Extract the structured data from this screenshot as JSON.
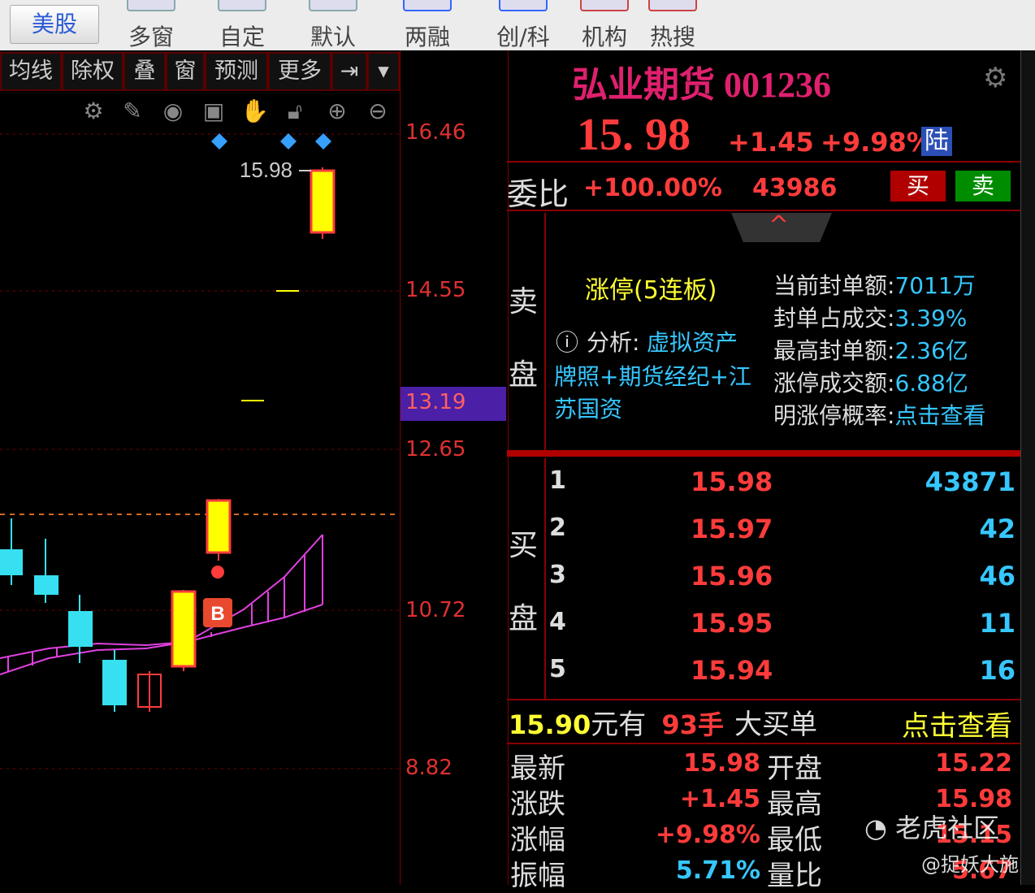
{
  "toolbar": {
    "market_button": "美股",
    "buttons": [
      "多窗",
      "自定",
      "默认",
      "两融",
      "创/科",
      "机构",
      "热搜"
    ]
  },
  "chart": {
    "indicator_tabs": [
      "均线",
      "除权",
      "叠",
      "窗",
      "预测",
      "更多"
    ],
    "tools": [
      "settings-icon",
      "pen-icon",
      "eye-icon",
      "basket-icon",
      "hand-icon",
      "lock-icon",
      "zoom-in-icon",
      "zoom-out-icon"
    ],
    "high_label": "15.98",
    "buy_marker": "B"
  },
  "axis": {
    "ticks": [
      "16.46",
      "14.55",
      "13.19",
      "12.65",
      "10.72",
      "8.82"
    ],
    "highlight": "13.19"
  },
  "quote": {
    "name_code": "弘业期货 001236",
    "price": "15. 98",
    "change": "+1.45",
    "change_pct": "+9.98%",
    "exchange_badge": "陆",
    "weibi_label": "委比",
    "weibi_value": "+100.00%",
    "weibi_qty": "43986",
    "buy_btn": "买",
    "sell_btn": "卖"
  },
  "limit_up": {
    "side_label_1": "卖",
    "side_label_2": "盘",
    "title": "涨停(5连板)",
    "analysis_label": "分析:",
    "analysis_text_1": "虚拟资产",
    "analysis_text_2": "牌照+期货经纪+江",
    "analysis_text_3": "苏国资",
    "stats": [
      {
        "label": "当前封单额:",
        "value": "7011万"
      },
      {
        "label": "封单占成交:",
        "value": "3.39%"
      },
      {
        "label": "最高封单额:",
        "value": "2.36亿"
      },
      {
        "label": "涨停成交额:",
        "value": "6.88亿"
      },
      {
        "label": "明涨停概率:",
        "value": "点击查看"
      }
    ]
  },
  "bids": {
    "side_label_1": "买",
    "side_label_2": "盘",
    "rows": [
      {
        "level": "1",
        "price": "15.98",
        "qty": "43871"
      },
      {
        "level": "2",
        "price": "15.97",
        "qty": "42"
      },
      {
        "level": "3",
        "price": "15.96",
        "qty": "46"
      },
      {
        "level": "4",
        "price": "15.95",
        "qty": "11"
      },
      {
        "level": "5",
        "price": "15.94",
        "qty": "16"
      }
    ]
  },
  "big_order": {
    "price": "15.90",
    "unit": "元有",
    "hands": "93手",
    "text": "大买单",
    "link": "点击查看"
  },
  "stats": [
    {
      "label": "最新",
      "value": "15.98",
      "label2": "开盘",
      "value2": "15.22"
    },
    {
      "label": "涨跌",
      "value": "+1.45",
      "label2": "最高",
      "value2": "15.98"
    },
    {
      "label": "涨幅",
      "value": "+9.98%",
      "label2": "最低",
      "value2": "15.15"
    },
    {
      "label": "振幅",
      "value": "5.71%",
      "label2": "量比",
      "value2": "5.67"
    }
  ],
  "watermark": {
    "brand": "老虎社区",
    "user": "@捉妖大施"
  },
  "colors": {
    "up": "#ff3b3b",
    "down": "#36c7ff",
    "ma": "#e040e0",
    "accent": "#ffff33"
  }
}
